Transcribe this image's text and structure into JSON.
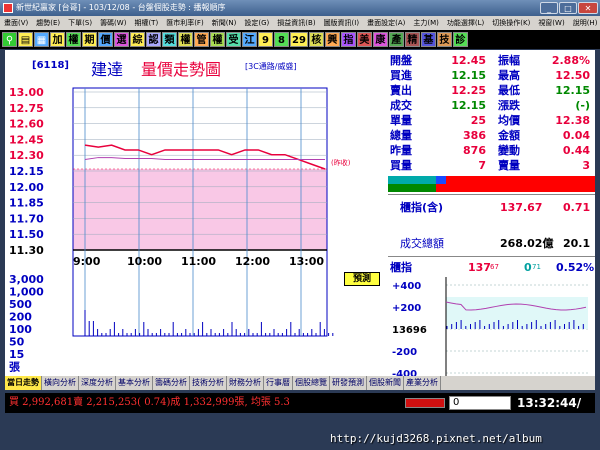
{
  "window": {
    "title": "新世紀贏家 [台哥] - 103/12/08 - 台盤個股走勢 : 播報順序",
    "minimize": "_",
    "maximize": "□",
    "close": "✕"
  },
  "menubar": [
    "畫面(V)",
    "趨勢(E)",
    "下單(S)",
    "籌碼(W)",
    "期權(T)",
    "匯市利率(F)",
    "新聞(N)",
    "設定(G)",
    "損益資訊(B)",
    "圖版資訊(I)",
    "畫面設定(A)",
    "主力(M)",
    "功能選擇(L)",
    "切換操作(K)",
    "視窗(W)",
    "說明(H)"
  ],
  "toolbar": [
    "加",
    "權",
    "期",
    "價",
    "選",
    "綜",
    "認",
    "類",
    "權",
    "管",
    "權",
    "受",
    "江",
    "9",
    "8",
    "29",
    "核",
    "興",
    "指",
    "美",
    "康",
    "產",
    "精",
    "基",
    "技",
    "診"
  ],
  "chart": {
    "stock_code": "[6118]",
    "stock_name": "建達",
    "chart_title": "量價走勢圖",
    "category": "[3C通路/威盛]",
    "price_ticks": [
      "13.00",
      "12.75",
      "12.60",
      "12.45",
      "12.30",
      "12.15",
      "12.00",
      "11.85",
      "11.70",
      "11.50",
      "11.30"
    ],
    "volume_ticks": [
      "3,000",
      "1,000",
      "500",
      "200",
      "100",
      "50",
      "15",
      "張"
    ],
    "time_ticks": [
      "9:00",
      "10:00",
      "11:00",
      "12:00",
      "13:00"
    ],
    "ref_label": "(昨收)",
    "predict_label": "預測"
  },
  "chart_data": {
    "type": "line",
    "x": [
      "9:00",
      "9:15",
      "9:30",
      "9:45",
      "10:00",
      "10:15",
      "10:30",
      "10:45",
      "11:00",
      "11:15",
      "11:30",
      "11:45",
      "12:00",
      "12:15",
      "12:30",
      "12:45",
      "13:00",
      "13:15",
      "13:30"
    ],
    "series": [
      {
        "values": [
          12.4,
          12.38,
          12.4,
          12.35,
          12.35,
          12.3,
          12.35,
          12.35,
          12.35,
          12.35,
          12.35,
          12.3,
          12.35,
          12.35,
          12.3,
          12.3,
          12.25,
          12.2,
          12.15
        ]
      },
      {
        "values": [
          12.25,
          12.27,
          12.27,
          12.26,
          12.26,
          12.26,
          12.25,
          12.25,
          12.25,
          12.25,
          12.25,
          12.25,
          12.25,
          12.25,
          12.25,
          12.25,
          12.25,
          12.25,
          12.25
        ]
      }
    ],
    "ylim": [
      11.3,
      13.0
    ],
    "reference_price": 12.15
  },
  "quote": {
    "rows": [
      [
        "開盤",
        "12.45",
        "振幅",
        "2.88%"
      ],
      [
        "買進",
        "12.15",
        "最高",
        "12.50"
      ],
      [
        "賣出",
        "12.25",
        "最低",
        "12.15"
      ],
      [
        "成交",
        "12.15",
        "漲跌",
        "(-)"
      ],
      [
        "單量",
        "25",
        "均價",
        "12.38"
      ],
      [
        "總量",
        "386",
        "金額",
        "0.04"
      ],
      [
        "昨量",
        "876",
        "變動",
        "0.44"
      ],
      [
        "買量",
        "7",
        "賣量",
        "3"
      ]
    ],
    "warrant_label": "櫃指(含)",
    "warrant_value": "137.67",
    "warrant_change": "0.71",
    "total_label": "成交總額",
    "total_value": "268.02億",
    "total_change": "20.1"
  },
  "index": {
    "label": "櫃指",
    "value": "137",
    "value_suffix": "67",
    "change": "0",
    "change_suffix": "71",
    "pct": "0.52%",
    "ticks": [
      "+400",
      "+200",
      "13696",
      "-200",
      "-400"
    ]
  },
  "tabs": [
    "當日走勢",
    "橫向分析",
    "深度分析",
    "基本分析",
    "籌碼分析",
    "技術分析",
    "財務分析",
    "行事曆",
    "個股總覽",
    "研發預測",
    "個股新聞",
    "產業分析"
  ],
  "status": {
    "summary": "買 2,992,681賣 2,215,253( 0.74)成 1,332,999張, 均張 5.3",
    "box_value": "0",
    "clock": "13:32:44/"
  },
  "watermark": "http://kujd3268.pixnet.net/album",
  "colors": {
    "price_up": "#e8003c",
    "price_down": "#00a000",
    "label": "#0000c0",
    "pink_fill": "#f9c8e6"
  }
}
